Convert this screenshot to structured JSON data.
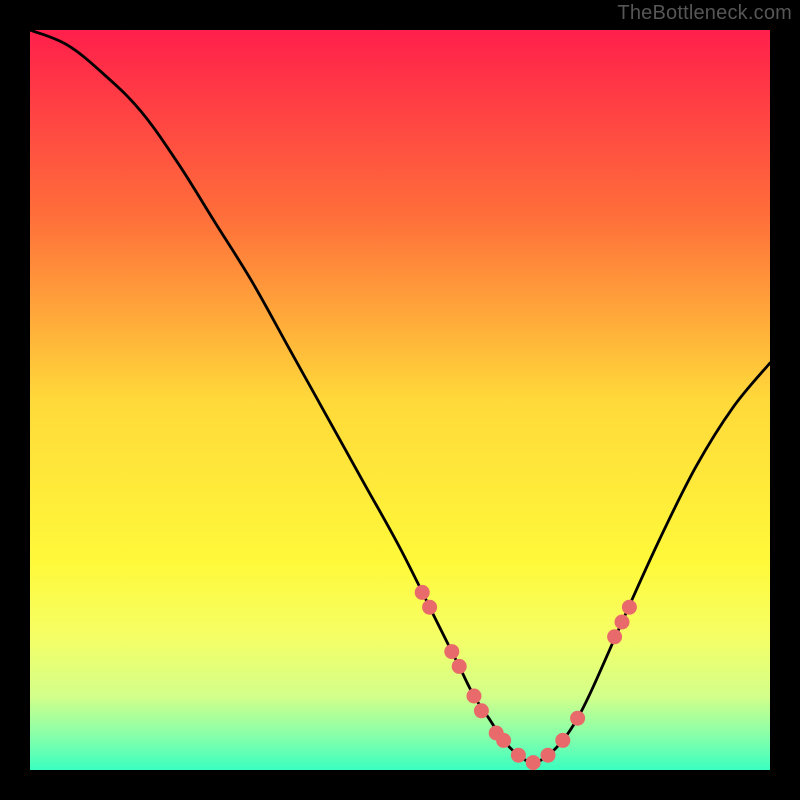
{
  "watermark": "TheBottleneck.com",
  "chart_data": {
    "type": "line",
    "title": "",
    "xlabel": "",
    "ylabel": "",
    "xlim": [
      0,
      100
    ],
    "ylim": [
      0,
      100
    ],
    "curve_description": "V-shaped bottleneck curve; high at left, descends to near-zero minimum around x≈68, then rises toward the right edge.",
    "series": [
      {
        "name": "bottleneck-curve",
        "x": [
          0,
          5,
          10,
          15,
          20,
          25,
          30,
          35,
          40,
          45,
          50,
          55,
          58,
          60,
          62,
          64,
          66,
          68,
          70,
          72,
          74,
          76,
          80,
          85,
          90,
          95,
          100
        ],
        "values": [
          100,
          98,
          94,
          89,
          82,
          74,
          66,
          57,
          48,
          39,
          30,
          20,
          14,
          10,
          7,
          4,
          2,
          1,
          2,
          4,
          7,
          11,
          20,
          31,
          41,
          49,
          55
        ]
      }
    ],
    "scatter": {
      "name": "sample-points",
      "x": [
        53,
        54,
        57,
        58,
        60,
        61,
        63,
        64,
        66,
        68,
        70,
        72,
        74,
        79,
        80,
        81
      ],
      "values": [
        24,
        22,
        16,
        14,
        10,
        8,
        5,
        4,
        2,
        1,
        2,
        4,
        7,
        18,
        20,
        22
      ]
    },
    "gradient_stops": [
      {
        "offset": 0.0,
        "color": "#ff1f4b"
      },
      {
        "offset": 0.25,
        "color": "#ff6e3a"
      },
      {
        "offset": 0.5,
        "color": "#ffd93a"
      },
      {
        "offset": 0.72,
        "color": "#fff93a"
      },
      {
        "offset": 0.82,
        "color": "#f5ff66"
      },
      {
        "offset": 0.9,
        "color": "#d3ff8a"
      },
      {
        "offset": 0.96,
        "color": "#7dffad"
      },
      {
        "offset": 1.0,
        "color": "#3affc0"
      }
    ],
    "scatter_color": "#e86a6a",
    "curve_color": "#000000"
  }
}
